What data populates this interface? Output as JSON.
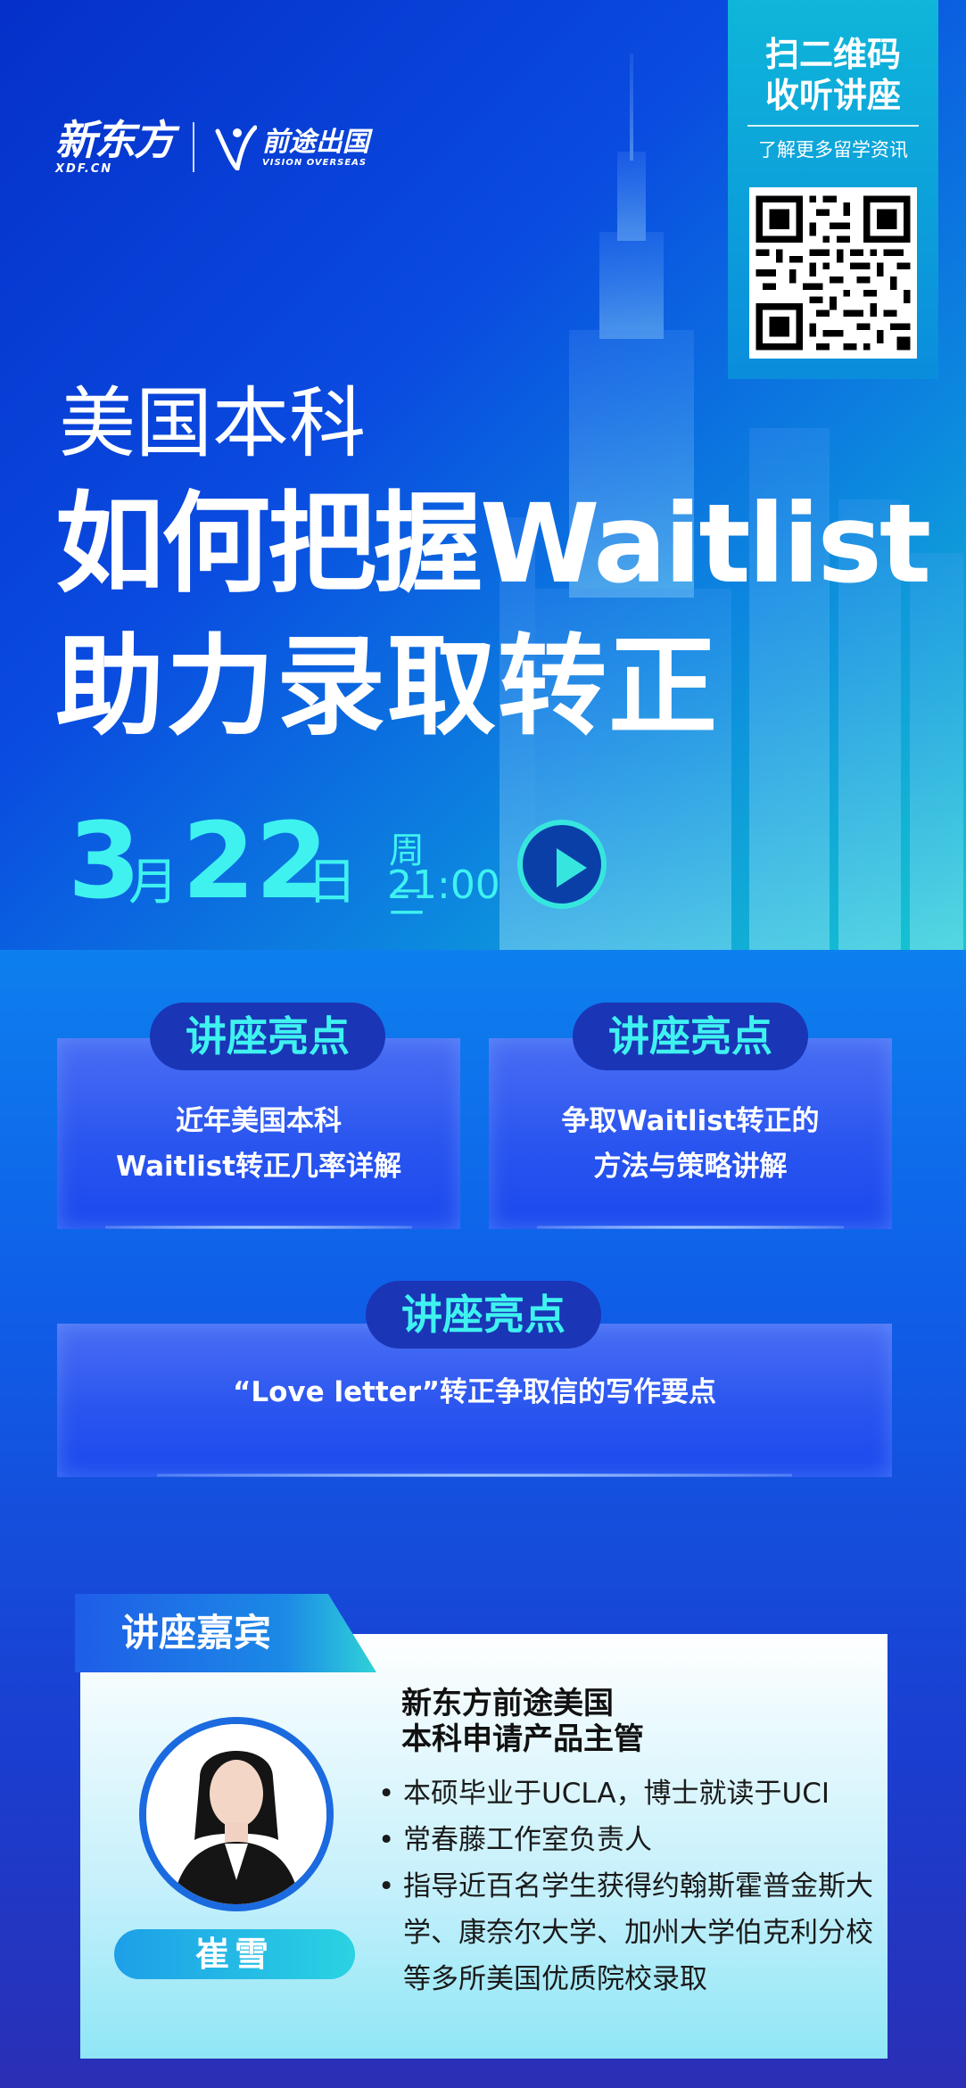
{
  "brand": {
    "xdf_name": "新东方",
    "xdf_domain": "XDF.CN",
    "vo_name": "前途出国",
    "vo_en": "VISION OVERSEAS"
  },
  "qr": {
    "title_line1": "扫二维码",
    "title_line2": "收听讲座",
    "subtitle": "了解更多留学资讯"
  },
  "hero": {
    "title1": "美国本科",
    "title2": "如何把握Waitlist",
    "title3": "助力录取转正"
  },
  "schedule": {
    "month_num": "3",
    "month_unit": "月",
    "day_num": "22",
    "day_unit": "日",
    "weekday": "周 二",
    "time": "21:00"
  },
  "highlights": [
    {
      "tag": "讲座亮点",
      "line1": "近年美国本科",
      "line2": "Waitlist转正几率详解"
    },
    {
      "tag": "讲座亮点",
      "line1": "争取Waitlist转正的",
      "line2": "方法与策略讲解"
    },
    {
      "tag": "讲座亮点",
      "line1": "“Love letter”转正争取信的写作要点"
    }
  ],
  "guest": {
    "section_label": "讲座嘉宾",
    "name": "崔雪",
    "title_line1": "新东方前途美国",
    "title_line2": "本科申请产品主管",
    "bullets": [
      "本硕毕业于UCLA，博士就读于UCI",
      "常春藤工作室负责人",
      "指导近百名学生获得约翰斯霍普金斯大学、康奈尔大学、加州大学伯克利分校等多所美国优质院校录取"
    ]
  },
  "colors": {
    "accent_cyan": "#3ff2f0",
    "deep_blue": "#1a35b6",
    "hero_blue": "#0530c9"
  }
}
